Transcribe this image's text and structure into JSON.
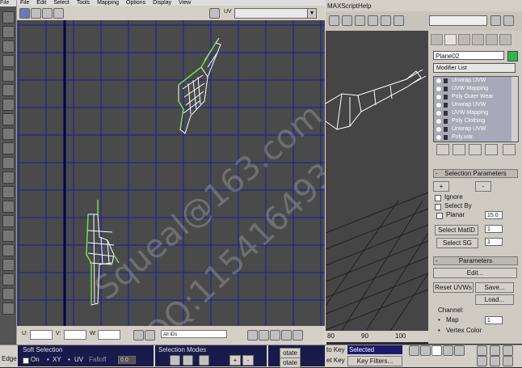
{
  "uv_editor": {
    "menu": [
      "File",
      "Edit",
      "Select",
      "Tools",
      "Mapping",
      "Options",
      "Display",
      "View"
    ],
    "uv_label": "UV",
    "uv_value": "",
    "bottom": {
      "u_label": "U:",
      "v_label": "V:",
      "w_label": "W:",
      "id_filter": "All IDs"
    }
  },
  "max_menu": [
    "MAXScript",
    "Help"
  ],
  "command_panel": {
    "object_name": "Plane02",
    "object_color": "#2fb54a",
    "modifier_list": "Modifier List",
    "modifiers": [
      "Unwrap UVW",
      "UVW Mapping",
      "Poly Outer Wear",
      "Unwrap UVW",
      "UVW Mapping",
      "Poly Clothing",
      "Unwrap UVW",
      "Poly.war"
    ],
    "selection_parameters": {
      "title": "Selection Parameters",
      "plus": "+",
      "minus": "-",
      "ignore": "Ignore",
      "select_by": "Select By",
      "planar": "Planar",
      "planar_value": "15.0",
      "select_matid": "Select MatID",
      "matid_value": "1",
      "select_sg": "Select SG",
      "sg_value": "1"
    },
    "parameters": {
      "title": "Parameters",
      "edit": "Edit...",
      "reset_uvws": "Reset UVWs",
      "save": "Save...",
      "load": "Load...",
      "channel": "Channel:",
      "map": "Map",
      "map_value": "1",
      "vertex_color": "Vertex Color"
    }
  },
  "timeline": {
    "ticks": [
      "80",
      "90",
      "100"
    ]
  },
  "bottombar": {
    "edge_label": "Edge",
    "soft_selection": "Soft Selection",
    "on": "On",
    "xy": "XY",
    "uv": "UV",
    "falloff": "Falloff",
    "falloff_value": "0.0",
    "selection_modes": "Selection Modes",
    "rotate1": "otate",
    "rotate2": "otate",
    "set_key": "et Key",
    "selected": "Selected",
    "set_key2": "et Key",
    "key_filters": "Key Filters...",
    "auto_key": "to Key"
  },
  "watermark": {
    "line1": "Squeal@163.com",
    "line2": "QQ:115416493"
  }
}
